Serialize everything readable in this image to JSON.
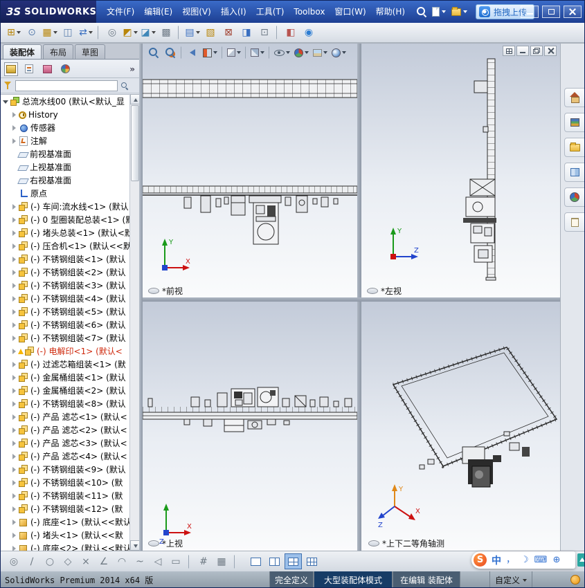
{
  "titlebar": {
    "brand_prefix": "3S",
    "brand": "SOLIDWORKS",
    "menus": [
      {
        "label": "文件(F)"
      },
      {
        "label": "编辑(E)"
      },
      {
        "label": "视图(V)"
      },
      {
        "label": "插入(I)"
      },
      {
        "label": "工具(T)"
      },
      {
        "label": "Toolbox"
      },
      {
        "label": "窗口(W)"
      },
      {
        "label": "帮助(H)"
      }
    ],
    "upload_button": "拖拽上传"
  },
  "main_toolbar": {
    "icons": [
      {
        "name": "insert-components-icon",
        "g": "⊞",
        "c": "#b8860b",
        "dd": "dd"
      },
      {
        "name": "mate-icon",
        "g": "⊙",
        "c": "#5b7fae"
      },
      {
        "name": "linear-component-pattern-icon",
        "g": "▦",
        "c": "#b8860b",
        "dd": "dd"
      },
      {
        "name": "smart-fasteners-icon",
        "g": "◫",
        "c": "#5b7fae"
      },
      {
        "name": "move-component-icon",
        "g": "⇄",
        "c": "#3a6fc0",
        "dd": "dd"
      },
      {
        "cls": "sep"
      },
      {
        "name": "show-hidden-components-icon",
        "g": "◎",
        "c": "#6e7a86"
      },
      {
        "name": "assembly-features-icon",
        "g": "◩",
        "c": "#b8860b",
        "dd": "dd"
      },
      {
        "name": "reference-geometry-icon",
        "g": "◪",
        "c": "#3f87b8",
        "dd": "dd"
      },
      {
        "name": "new-motion-study-icon",
        "g": "▩",
        "c": "#6e7a86"
      },
      {
        "cls": "sep"
      },
      {
        "name": "bill-of-materials-icon",
        "g": "▤",
        "c": "#3a6fc0",
        "dd": "dd"
      },
      {
        "name": "exploded-view-icon",
        "g": "▧",
        "c": "#b8860b"
      },
      {
        "name": "interference-detection-icon",
        "g": "⊠",
        "c": "#a04030"
      },
      {
        "name": "measure-icon",
        "g": "◨",
        "c": "#3a6fc0"
      },
      {
        "name": "mass-properties-icon",
        "g": "⊡",
        "c": "#6e7a86"
      },
      {
        "cls": "sep"
      },
      {
        "name": "section-properties-icon",
        "g": "◧",
        "c": "#b85450"
      },
      {
        "name": "sensors-icon",
        "g": "◉",
        "c": "#2d7dd2"
      }
    ]
  },
  "panel": {
    "tabs": [
      {
        "label": "装配体",
        "cls": "active"
      },
      {
        "label": "布局"
      },
      {
        "label": "草图"
      }
    ],
    "header_icons": [
      {
        "name": "featuremanager-tab-icon",
        "kind": "ph-tree",
        "cls": "framed"
      },
      {
        "name": "propertymanager-tab-icon",
        "kind": "ph-prop"
      },
      {
        "name": "configurationmanager-tab-icon",
        "kind": "ph-conf"
      },
      {
        "name": "displaymanager-tab-icon",
        "kind": "ph-ball"
      }
    ],
    "chevron": "»",
    "filter": {
      "value": ""
    },
    "tree": [
      {
        "cls": "rootrow",
        "caret": "cr-o",
        "icon": "ic-root",
        "label": "总流水线00 (默认<默认_显"
      },
      {
        "cls": "child",
        "caret": "cr-c",
        "icon": "ic-hist",
        "label": "History"
      },
      {
        "cls": "child",
        "caret": "cr-c",
        "icon": "ic-sensor",
        "label": "传感器"
      },
      {
        "cls": "child",
        "caret": "cr-c",
        "icon": "ic-ann",
        "label": "注解"
      },
      {
        "cls": "child",
        "caret": "cr-n",
        "icon": "ic-plane",
        "label": "前视基准面"
      },
      {
        "cls": "child",
        "caret": "cr-n",
        "icon": "ic-plane",
        "label": "上视基准面"
      },
      {
        "cls": "child",
        "caret": "cr-n",
        "icon": "ic-plane",
        "label": "右视基准面"
      },
      {
        "cls": "child",
        "caret": "cr-n",
        "icon": "ic-origin",
        "label": "原点"
      },
      {
        "cls": "child",
        "caret": "cr-c",
        "icon": "ic-asm",
        "label": "(-) 车间:流水线<1> (默认"
      },
      {
        "cls": "child",
        "caret": "cr-c",
        "icon": "ic-asm",
        "label": "(-) 0 型圈装配总装<1> (默"
      },
      {
        "cls": "child",
        "caret": "cr-c",
        "icon": "ic-asm",
        "label": "(-) 堵头总装<1> (默认<默"
      },
      {
        "cls": "child",
        "caret": "cr-c",
        "icon": "ic-asm",
        "label": "(-) 压合机<1> (默认<<默"
      },
      {
        "cls": "child",
        "caret": "cr-c",
        "icon": "ic-asm",
        "label": "(-) 不锈钢组装<1> (默认"
      },
      {
        "cls": "child",
        "caret": "cr-c",
        "icon": "ic-asm",
        "label": "(-) 不锈钢组装<2> (默认"
      },
      {
        "cls": "child",
        "caret": "cr-c",
        "icon": "ic-asm",
        "label": "(-) 不锈钢组装<3> (默认"
      },
      {
        "cls": "child",
        "caret": "cr-c",
        "icon": "ic-asm",
        "label": "(-) 不锈钢组装<4> (默认"
      },
      {
        "cls": "child",
        "caret": "cr-c",
        "icon": "ic-asm",
        "label": "(-) 不锈钢组装<5> (默认"
      },
      {
        "cls": "child",
        "caret": "cr-c",
        "icon": "ic-asm",
        "label": "(-) 不锈钢组装<6> (默认"
      },
      {
        "cls": "child",
        "caret": "cr-c",
        "icon": "ic-asm",
        "label": "(-) 不锈钢组装<7> (默认"
      },
      {
        "cls": "child warn",
        "caret": "cr-c",
        "icon": "ic-asm",
        "tcls": "red",
        "label": "(-) 电解印<1> (默认<"
      },
      {
        "cls": "child",
        "caret": "cr-c",
        "icon": "ic-asm",
        "label": "(-) 过滤芯箱组装<1> (默"
      },
      {
        "cls": "child",
        "caret": "cr-c",
        "icon": "ic-asm",
        "label": "(-) 金属桶组装<1> (默认"
      },
      {
        "cls": "child",
        "caret": "cr-c",
        "icon": "ic-asm",
        "label": "(-) 金属桶组装<2> (默认"
      },
      {
        "cls": "child",
        "caret": "cr-c",
        "icon": "ic-asm",
        "label": "(-) 不锈钢组装<8> (默认"
      },
      {
        "cls": "child",
        "caret": "cr-c",
        "icon": "ic-asm",
        "label": "(-) 产品 滤芯<1> (默认<"
      },
      {
        "cls": "child",
        "caret": "cr-c",
        "icon": "ic-asm",
        "label": "(-) 产品 滤芯<2> (默认<"
      },
      {
        "cls": "child",
        "caret": "cr-c",
        "icon": "ic-asm",
        "label": "(-) 产品 滤芯<3> (默认<"
      },
      {
        "cls": "child",
        "caret": "cr-c",
        "icon": "ic-asm",
        "label": "(-) 产品 滤芯<4> (默认<"
      },
      {
        "cls": "child",
        "caret": "cr-c",
        "icon": "ic-asm",
        "label": "(-) 不锈钢组装<9> (默认"
      },
      {
        "cls": "child",
        "caret": "cr-c",
        "icon": "ic-asm",
        "label": "(-) 不锈钢组装<10> (默"
      },
      {
        "cls": "child",
        "caret": "cr-c",
        "icon": "ic-asm",
        "label": "(-) 不锈钢组装<11> (默"
      },
      {
        "cls": "child",
        "caret": "cr-c",
        "icon": "ic-asm",
        "label": "(-) 不锈钢组装<12> (默"
      },
      {
        "cls": "child",
        "caret": "cr-c",
        "icon": "ic-part",
        "label": "(-) 底座<1> (默认<<默认"
      },
      {
        "cls": "child",
        "caret": "cr-c",
        "icon": "ic-part",
        "label": "(-) 堵头<1> (默认<<默"
      },
      {
        "cls": "child",
        "caret": "cr-c",
        "icon": "ic-part",
        "label": "(-) 底座<2> (默认<<默认"
      }
    ]
  },
  "heads_up": {
    "icons": [
      {
        "name": "zoom-fit-icon",
        "kind": "hz-mag"
      },
      {
        "name": "zoom-to-area-icon",
        "kind": "hz-area"
      },
      {
        "cls": "sep"
      },
      {
        "name": "previous-view-icon",
        "kind": "hz-prev"
      },
      {
        "name": "section-view-icon",
        "kind": "hz-sect",
        "dd": "dd"
      },
      {
        "cls": "sep"
      },
      {
        "name": "view-orientation-icon",
        "kind": "hz-cube",
        "dd": "dd"
      },
      {
        "cls": "sep"
      },
      {
        "name": "display-style-icon",
        "kind": "hz-cube2",
        "dd": "dd"
      },
      {
        "cls": "sep"
      },
      {
        "name": "hide-show-items-icon",
        "kind": "hz-eye",
        "dd": "dd"
      },
      {
        "name": "edit-appearance-icon",
        "kind": "hz-ball",
        "dd": "dd"
      },
      {
        "name": "apply-scene-icon",
        "kind": "hz-scene",
        "dd": "dd"
      },
      {
        "name": "view-settings-icon",
        "kind": "hz-ball2",
        "dd": "dd"
      }
    ]
  },
  "viewports": {
    "front": {
      "label": "*前视",
      "axis_v": "Y",
      "axis_h": "X"
    },
    "left": {
      "label": "*左视",
      "axis_v": "Y",
      "axis_h": "Z"
    },
    "top": {
      "label": "*上视",
      "axis_h": "X",
      "axis_dot": "Z"
    },
    "iso": {
      "label": "*上下二等角轴测",
      "axis_y": "Y",
      "axis_x": "X",
      "axis_z": "Z"
    },
    "window_controls": [
      {
        "name": "viewport-grid-icon",
        "kind": "wc-grid"
      },
      {
        "name": "minimize-viewport-icon",
        "kind": "wc-min"
      },
      {
        "name": "restore-viewport-icon",
        "kind": "wc-rest"
      },
      {
        "name": "close-viewport-icon",
        "kind": "wc-close"
      }
    ]
  },
  "task_pane": {
    "icons": [
      {
        "name": "solidworks-resources-icon",
        "kind": "tp-home"
      },
      {
        "name": "design-library-icon",
        "kind": "tp-lib"
      },
      {
        "name": "file-explorer-icon",
        "kind": "tp-folder"
      },
      {
        "name": "view-palette-icon",
        "kind": "tp-pal"
      },
      {
        "name": "appearances-icon",
        "kind": "tp-ball"
      },
      {
        "name": "custom-properties-icon",
        "kind": "tp-doc"
      }
    ]
  },
  "bottom_toolbar": {
    "icons": [
      {
        "name": "smart-dimension-icon",
        "g": "◎"
      },
      {
        "name": "line-icon",
        "g": "∕"
      },
      {
        "name": "circle-icon",
        "g": "○"
      },
      {
        "name": "polygon-icon",
        "g": "◇"
      },
      {
        "name": "trim-entities-icon",
        "g": "×"
      },
      {
        "name": "angle-icon",
        "g": "∠"
      },
      {
        "name": "arc-icon",
        "g": "◠"
      },
      {
        "name": "spline-icon",
        "g": "~"
      },
      {
        "name": "mirror-entities-icon",
        "g": "◁"
      },
      {
        "name": "offset-entities-icon",
        "g": "▭"
      },
      {
        "cls": "sep"
      },
      {
        "name": "grid-icon",
        "g": "#"
      },
      {
        "name": "snap-icon",
        "g": "▦"
      },
      {
        "cls": "sep"
      }
    ],
    "view_buttons": [
      {
        "name": "single-viewport-button",
        "kind": "v1"
      },
      {
        "name": "two-viewport-button",
        "kind": "v2"
      },
      {
        "name": "four-viewport-button",
        "kind": "v4",
        "cls": "active"
      },
      {
        "name": "viewport-grid-button",
        "kind": "vg"
      }
    ]
  },
  "sogou": {
    "logo": "S",
    "mode": "中",
    "icons": [
      {
        "name": "punctuation-icon",
        "glyph": "，"
      },
      {
        "name": "moon-icon",
        "glyph": "☽"
      },
      {
        "name": "keyboard-icon",
        "glyph": "⌨"
      },
      {
        "name": "skin-icon",
        "glyph": "⊕"
      }
    ]
  },
  "statusbar": {
    "left": "SolidWorks Premium 2014 x64 版",
    "fully_defined": "完全定义",
    "large_assembly": "大型装配体模式",
    "editing": "在编辑 装配体",
    "custom": "自定义"
  }
}
